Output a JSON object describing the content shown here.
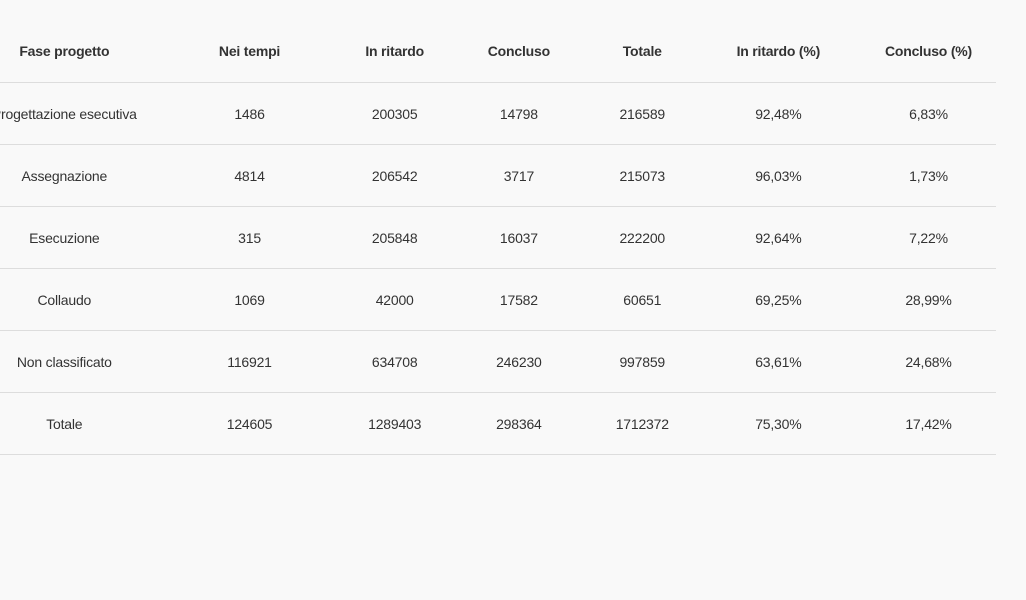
{
  "table": {
    "headers": [
      "Fase progetto",
      "Nei tempi",
      "In ritardo",
      "Concluso",
      "Totale",
      "In ritardo (%)",
      "Concluso (%)"
    ],
    "rows": [
      [
        "Progettazione esecutiva",
        "1486",
        "200305",
        "14798",
        "216589",
        "92,48%",
        "6,83%"
      ],
      [
        "Assegnazione",
        "4814",
        "206542",
        "3717",
        "215073",
        "96,03%",
        "1,73%"
      ],
      [
        "Esecuzione",
        "315",
        "205848",
        "16037",
        "222200",
        "92,64%",
        "7,22%"
      ],
      [
        "Collaudo",
        "1069",
        "42000",
        "17582",
        "60651",
        "69,25%",
        "28,99%"
      ],
      [
        "Non classificato",
        "116921",
        "634708",
        "246230",
        "997859",
        "63,61%",
        "24,68%"
      ],
      [
        "Totale",
        "124605",
        "1289403",
        "298364",
        "1712372",
        "75,30%",
        "17,42%"
      ]
    ]
  }
}
